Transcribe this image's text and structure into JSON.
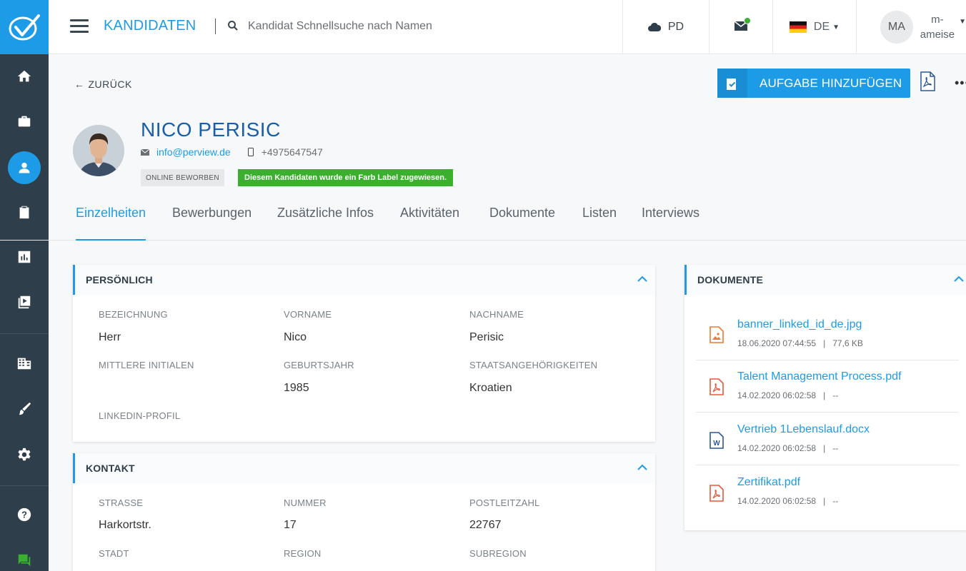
{
  "topbar": {
    "title": "KANDIDATEN",
    "search_placeholder": "Kandidat Schnellsuche nach Namen",
    "pd_label": "PD",
    "lang_label": "DE",
    "user_initials": "MA",
    "user_name_line1": "m-",
    "user_name_line2": "ameise"
  },
  "sidebar": {
    "items": [
      {
        "icon": "home-icon"
      },
      {
        "icon": "briefcase-icon"
      },
      {
        "icon": "user-icon",
        "active": true
      },
      {
        "icon": "clipboard-check-icon"
      },
      {
        "icon": "bar-chart-icon"
      },
      {
        "icon": "media-library-icon"
      },
      {
        "icon": "building-icon"
      },
      {
        "icon": "brush-icon"
      },
      {
        "icon": "settings-icon"
      },
      {
        "icon": "help-icon"
      },
      {
        "icon": "chat-icon"
      }
    ]
  },
  "header": {
    "back_label": "ZURÜCK",
    "add_task_label": "AUFGABE HINZUFÜGEN"
  },
  "candidate": {
    "name": "NICO PERISIC",
    "email": "info@perview.de",
    "phone": "+4975647547",
    "badge_source": "ONLINE BEWORBEN",
    "badge_label": "Diesem Kandidaten wurde ein Farb Label zugewiesen."
  },
  "tabs": [
    {
      "label": "Einzelheiten",
      "active": true
    },
    {
      "label": "Bewerbungen"
    },
    {
      "label": "Zusätzliche Infos"
    },
    {
      "label": "Aktivitäten"
    },
    {
      "label": "Dokumente"
    },
    {
      "label": "Listen"
    },
    {
      "label": "Interviews"
    }
  ],
  "personal": {
    "title": "PERSÖNLICH",
    "fields": [
      {
        "label": "BEZEICHNUNG",
        "value": "Herr"
      },
      {
        "label": "VORNAME",
        "value": "Nico"
      },
      {
        "label": "NACHNAME",
        "value": "Perisic"
      },
      {
        "label": "MITTLERE INITIALEN",
        "value": ""
      },
      {
        "label": "GEBURTSJAHR",
        "value": "1985"
      },
      {
        "label": "STAATSANGEHÖRIGKEITEN",
        "value": "Kroatien"
      },
      {
        "label": "LINKEDIN-PROFIL",
        "value": ""
      }
    ]
  },
  "contact": {
    "title": "KONTAKT",
    "fields": [
      {
        "label": "STRASSE",
        "value": "Harkortstr."
      },
      {
        "label": "NUMMER",
        "value": "17"
      },
      {
        "label": "POSTLEITZAHL",
        "value": "22767"
      },
      {
        "label": "STADT",
        "value": ""
      },
      {
        "label": "REGION",
        "value": ""
      },
      {
        "label": "SUBREGION",
        "value": ""
      }
    ]
  },
  "documents": {
    "title": "DOKUMENTE",
    "items": [
      {
        "name": "banner_linked_id_de.jpg",
        "date": "18.06.2020 07:44:55",
        "size": "77,6 KB",
        "type": "image",
        "color": "#f07a2a"
      },
      {
        "name": "Talent Management Process.pdf",
        "date": "14.02.2020 06:02:58",
        "size": "--",
        "type": "pdf",
        "color": "#e8563c"
      },
      {
        "name": "Vertrieb 1Lebenslauf.docx",
        "date": "14.02.2020 06:02:58",
        "size": "--",
        "type": "word",
        "color": "#2b5797"
      },
      {
        "name": "Zertifikat.pdf",
        "date": "14.02.2020 06:02:58",
        "size": "--",
        "type": "pdf",
        "color": "#e8563c"
      }
    ]
  },
  "colors": {
    "accent": "#1e9be6",
    "sidebar": "#2e3e4a",
    "name": "#1a5ea8",
    "label_green": "#3ab02e"
  }
}
